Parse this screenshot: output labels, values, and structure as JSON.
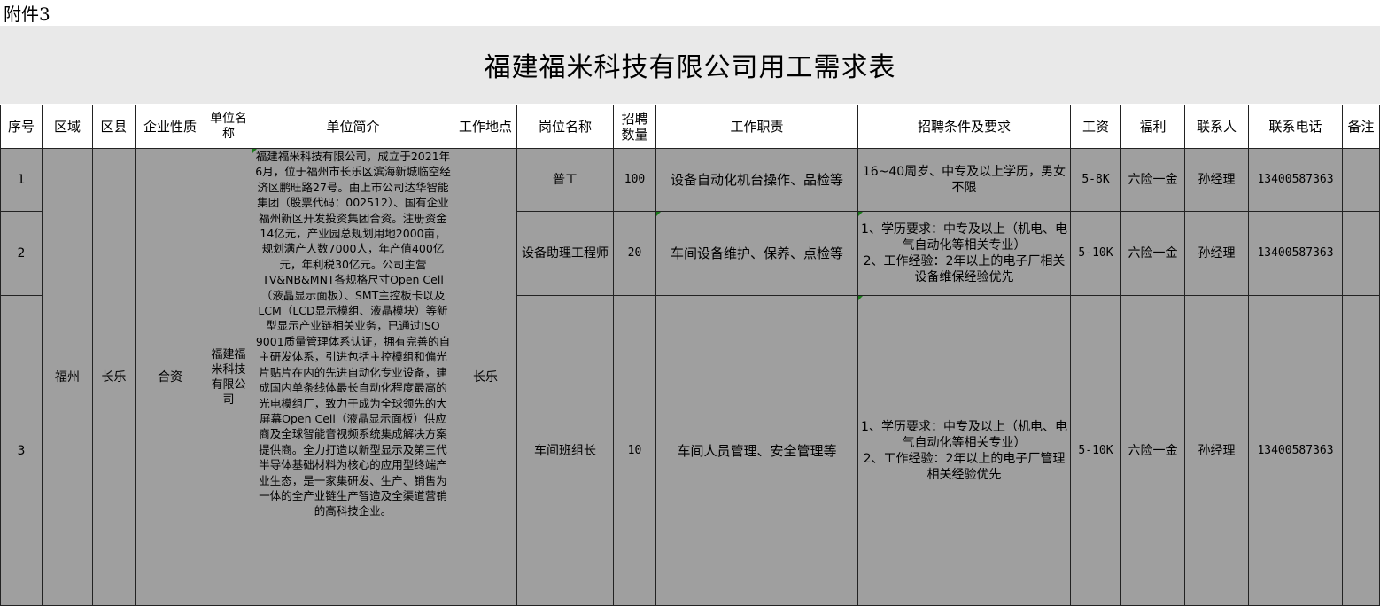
{
  "attachment_label": "附件3",
  "title": "福建福米科技有限公司用工需求表",
  "headers": [
    "序号",
    "区域",
    "区县",
    "企业性质",
    "单位名称",
    "单位简介",
    "工作地点",
    "岗位名称",
    "招聘数量",
    "工作职责",
    "招聘条件及要求",
    "工资",
    "福利",
    "联系人",
    "联系电话",
    "备注"
  ],
  "shared": {
    "region": "福州",
    "county": "长乐",
    "nature": "合资",
    "company": "福建福米科技有限公司",
    "intro": "福建福米科技有限公司，成立于2021年6月，位于福州市长乐区滨海新城临空经济区鹏旺路27号。由上市公司达华智能集团（股票代码：002512）、国有企业福州新区开发投资集团合资。注册资金14亿元，产业园总规划用地2000亩，规划满产人数7000人，年产值400亿元，年利税30亿元。公司主营TV&NB&MNT各规格尺寸Open Cell（液晶显示面板）、SMT主控板卡以及LCM（LCD显示模组、液晶模块）等新型显示产业链相关业务，已通过ISO 9001质量管理体系认证，拥有完善的自主研发体系，引进包括主控模组和偏光片贴片在内的先进自动化专业设备，建成国内单条线体最长自动化程度最高的光电模组厂，致力于成为全球领先的大屏幕Open Cell（液晶显示面板）供应商及全球智能音视频系统集成解决方案提供商。全力打造以新型显示及第三代半导体基础材料为核心的应用型终端产业生态，是一家集研发、生产、销售为一体的全产业链生产智造及全渠道营销的高科技企业。",
    "location": "长乐"
  },
  "rows": [
    {
      "no": "1",
      "position": "普工",
      "count": "100",
      "duty": "设备自动化机台操作、品检等",
      "requirements": "16~40周岁、中专及以上学历，男女不限",
      "salary": "5-8K",
      "welfare": "六险一金",
      "contact": "孙经理",
      "phone": "13400587363",
      "remark": ""
    },
    {
      "no": "2",
      "position": "设备助理工程师",
      "count": "20",
      "duty": "车间设备维护、保养、点检等",
      "requirements": "1、学历要求：中专及以上（机电、电气自动化等相关专业）\n2、工作经验：2年以上的电子厂相关设备维保经验优先",
      "salary": "5-10K",
      "welfare": "六险一金",
      "contact": "孙经理",
      "phone": "13400587363",
      "remark": ""
    },
    {
      "no": "3",
      "position": "车间班组长",
      "count": "10",
      "duty": "车间人员管理、安全管理等",
      "requirements": "1、学历要求：中专及以上（机电、电气自动化等相关专业）\n2、工作经验：2年以上的电子厂管理相关经验优先",
      "salary": "5-10K",
      "welfare": "六险一金",
      "contact": "孙经理",
      "phone": "13400587363",
      "remark": ""
    }
  ]
}
